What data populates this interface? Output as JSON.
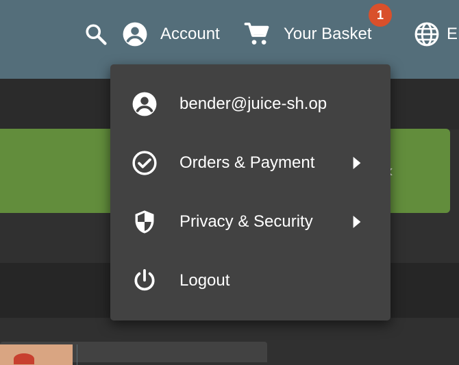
{
  "toolbar": {
    "account_label": "Account",
    "basket_label": "Your Basket",
    "basket_count": "1",
    "language_label": "EN"
  },
  "user_menu": {
    "items": [
      {
        "label": "bender@juice-sh.op",
        "icon": "account-circle-icon",
        "has_submenu": false
      },
      {
        "label": "Orders & Payment",
        "icon": "check-circle-icon",
        "has_submenu": true
      },
      {
        "label": "Privacy & Security",
        "icon": "shield-icon",
        "has_submenu": true
      },
      {
        "label": "Logout",
        "icon": "power-icon",
        "has_submenu": false
      }
    ]
  },
  "colors": {
    "toolbar": "#546e7a",
    "menu": "#424242",
    "banner": "#628d3c",
    "badge": "#d9502b",
    "background": "#303030"
  }
}
